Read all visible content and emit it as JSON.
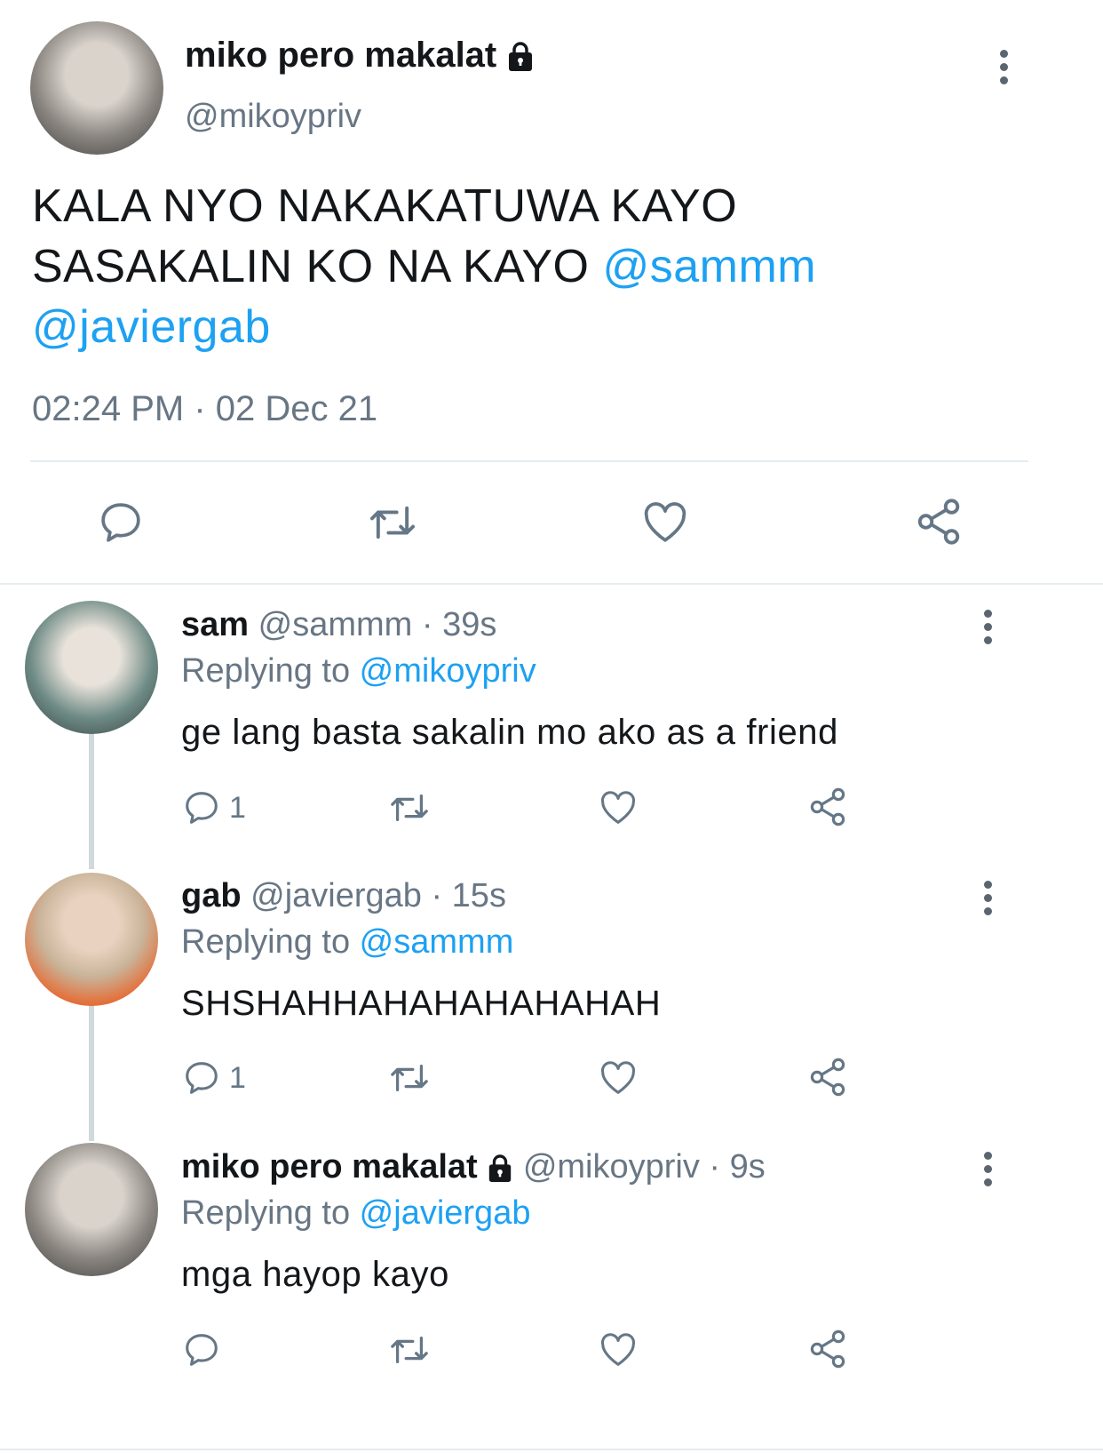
{
  "main_tweet": {
    "display_name": "miko pero makalat",
    "handle": "@mikoypriv",
    "text_line1": "KALA NYO NAKAKATUWA KAYO",
    "text_line2": "SASAKALIN KO NA KAYO ",
    "mention1": "@sammm",
    "mention2": "@javiergab",
    "timestamp": "02:24 PM · 02 Dec 21",
    "icons": [
      "reply-icon",
      "retweet-icon",
      "like-icon",
      "share-icon"
    ]
  },
  "replies": [
    {
      "display_name": "sam",
      "meta": "@sammm · 39s",
      "replying_label": "Replying to ",
      "replying_to": "@mikoypriv",
      "text": "ge lang basta sakalin mo ako as a friend",
      "reply_count": "1"
    },
    {
      "display_name": "gab",
      "meta": "@javiergab · 15s",
      "replying_label": "Replying to ",
      "replying_to": "@sammm",
      "text": "SHSHAHHAHAHAHAHAHAH",
      "reply_count": "1"
    },
    {
      "display_name": "miko pero makalat",
      "meta": "@mikoypriv · 9s",
      "replying_label": "Replying to ",
      "replying_to": "@javiergab",
      "text": "mga hayop kayo",
      "reply_count": ""
    }
  ],
  "colors": {
    "link": "#1da1f2",
    "secondary": "#687684",
    "divider": "#e6ecf0"
  }
}
